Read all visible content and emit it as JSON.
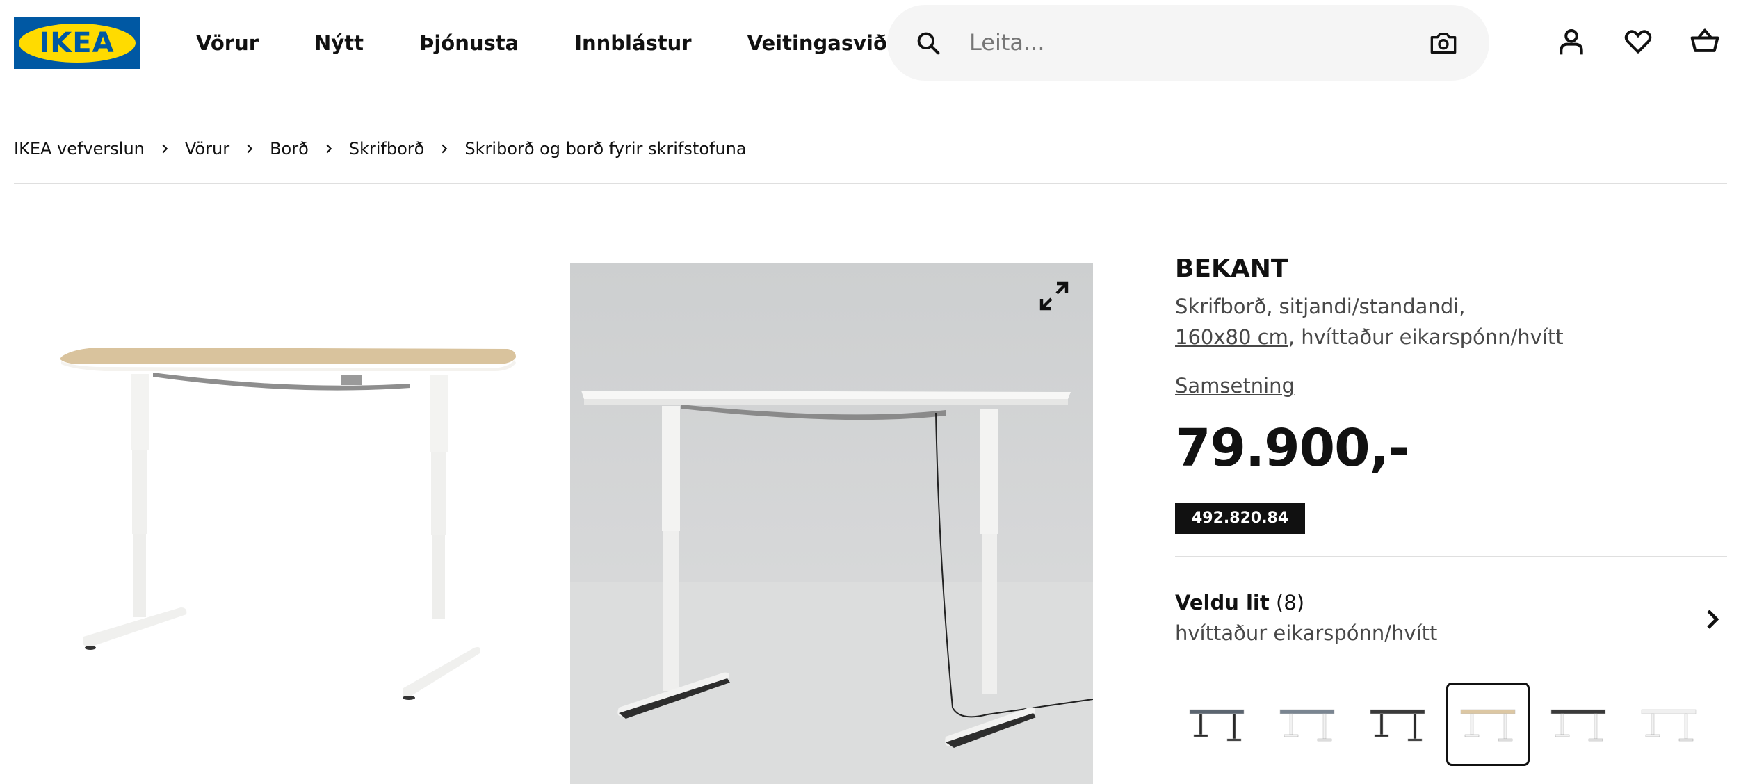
{
  "header": {
    "logo_text": "IKEA",
    "brand_colors": {
      "blue": "#0058a3",
      "yellow": "#ffdb00"
    },
    "nav": [
      "Vörur",
      "Nýtt",
      "Þjónusta",
      "Innblástur",
      "Veitingasvið"
    ],
    "search": {
      "placeholder": "Leita...",
      "value": "",
      "icon": "search-icon",
      "camera_icon": "camera-icon"
    },
    "icons": [
      "user-icon",
      "heart-icon",
      "basket-icon"
    ]
  },
  "breadcrumb": [
    "IKEA vefverslun",
    "Vörur",
    "Borð",
    "Skrifborð",
    "Skriborð og borð fyrir skrifstofuna"
  ],
  "product": {
    "name": "BEKANT",
    "description_line1": "Skrifborð, sitjandi/standandi,",
    "size_link": "160x80 cm",
    "description_line2_rest": ", hvíttaður eikarspónn/hvítt",
    "assembly_link": "Samsetning",
    "price": "79.900,-",
    "article_number": "492.820.84"
  },
  "color_select": {
    "label": "Veldu lit",
    "count": "(8)",
    "value": "hvíttaður eikarspónn/hvítt"
  },
  "swatches": [
    {
      "name": "dark-gray-black",
      "top": "#5b6570",
      "legs": "#2a2a2a",
      "selected": false
    },
    {
      "name": "gray-white",
      "top": "#7a8591",
      "legs": "#f2f2f2",
      "selected": false
    },
    {
      "name": "black-brown-black",
      "top": "#3a3a3a",
      "legs": "#2a2a2a",
      "selected": false
    },
    {
      "name": "oak-white",
      "top": "#dcc7a3",
      "legs": "#f2f2f2",
      "selected": true
    },
    {
      "name": "black-white",
      "top": "#3a3a3a",
      "legs": "#f2f2f2",
      "selected": false
    },
    {
      "name": "white-white",
      "top": "#f0f0f0",
      "legs": "#f2f2f2",
      "selected": false
    }
  ]
}
